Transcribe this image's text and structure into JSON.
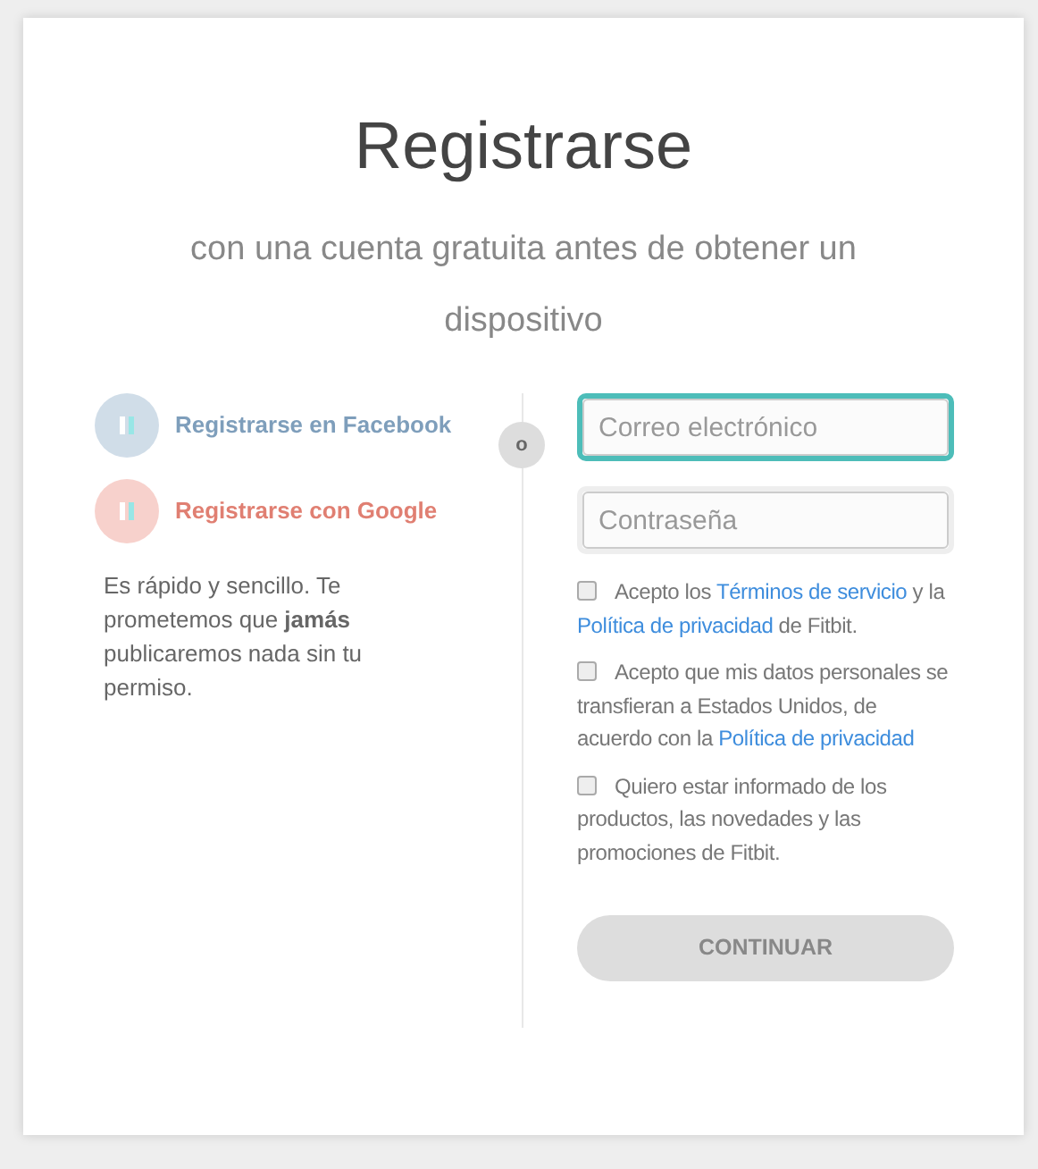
{
  "title": "Registrarse",
  "subtitle": "con una cuenta gratuita antes de obtener un dispositivo",
  "social_buttons": [
    {
      "kind": "facebook",
      "label": "Registrarse en Facebook",
      "disabled": true
    },
    {
      "kind": "google",
      "label": "Registrarse con Google",
      "disabled": true
    }
  ],
  "note": "Es rápido y sencillo. Te prometemos que **jamás** publicaremos nada sin tu permiso.",
  "divider": "o",
  "fields": [
    {
      "placeholder": "Correo electrónico",
      "focused": true
    },
    {
      "placeholder": "Contraseña",
      "focused": false
    }
  ],
  "checkboxes": [
    {
      "checked": false,
      "parts": [
        {
          "text": "Acepto los ",
          "kind": "text"
        },
        {
          "text": "Términos de servicio",
          "kind": "link"
        },
        {
          "text": " y la ",
          "kind": "text"
        },
        {
          "text": "Política de privacidad",
          "kind": "link"
        },
        {
          "text": " de Fitbit.",
          "kind": "text"
        }
      ]
    },
    {
      "checked": false,
      "parts": [
        {
          "text": "Acepto que mis datos personales se transfieran a Estados Unidos, de acuerdo con la ",
          "kind": "text"
        },
        {
          "text": "Política de privacidad",
          "kind": "link"
        }
      ]
    },
    {
      "checked": false,
      "parts": [
        {
          "text": "Quiero estar informado de los productos, las novedades y las promociones de Fitbit.",
          "kind": "text"
        }
      ]
    }
  ],
  "submit": {
    "label": "CONTINUAR",
    "disabled": true
  }
}
